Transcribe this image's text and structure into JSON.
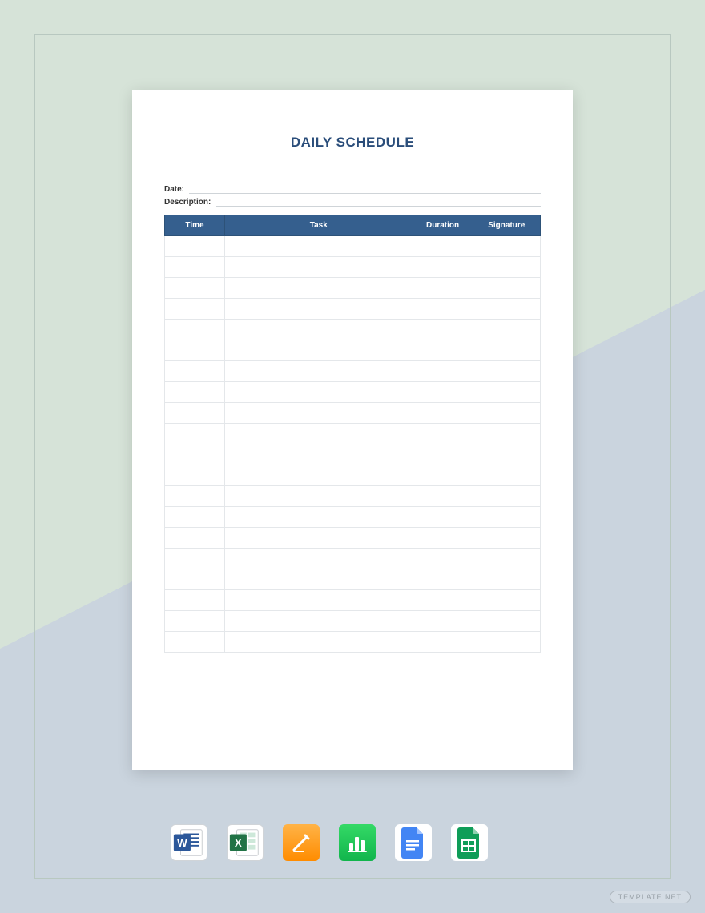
{
  "document": {
    "title": "DAILY SCHEDULE",
    "fields": {
      "date_label": "Date:",
      "description_label": "Description:"
    },
    "table": {
      "headers": [
        "Time",
        "Task",
        "Duration",
        "Signature"
      ],
      "row_count": 20
    }
  },
  "icons": [
    {
      "name": "word-icon",
      "brand_color": "#2b579a",
      "letter": "W"
    },
    {
      "name": "excel-icon",
      "brand_color": "#217346",
      "letter": "X"
    },
    {
      "name": "pages-icon",
      "brand_color": "#ff9500",
      "letter": ""
    },
    {
      "name": "numbers-icon",
      "brand_color": "#30d158",
      "letter": ""
    },
    {
      "name": "gdocs-icon",
      "brand_color": "#4285f4",
      "letter": ""
    },
    {
      "name": "gsheets-icon",
      "brand_color": "#0f9d58",
      "letter": ""
    }
  ],
  "watermark": "TEMPLATE.NET"
}
